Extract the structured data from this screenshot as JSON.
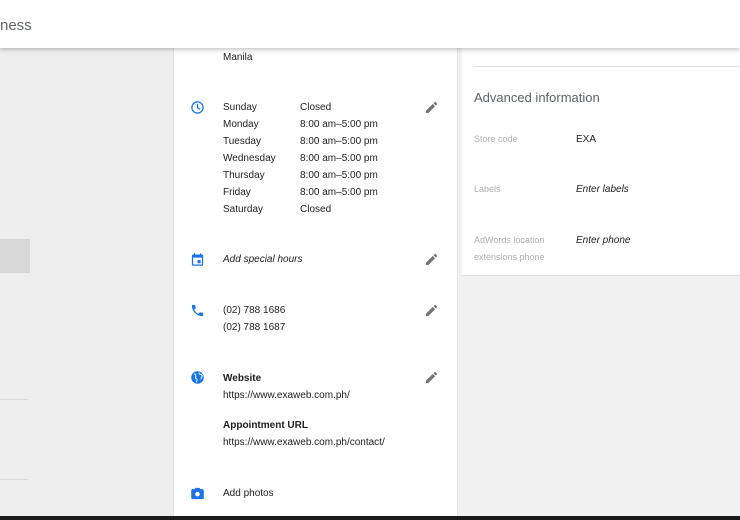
{
  "search": {
    "text": "ness"
  },
  "address": {
    "city": "Manila"
  },
  "hours": [
    {
      "day": "Sunday",
      "time": "Closed"
    },
    {
      "day": "Monday",
      "time": "8:00 am–5:00 pm"
    },
    {
      "day": "Tuesday",
      "time": "8:00 am–5:00 pm"
    },
    {
      "day": "Wednesday",
      "time": "8:00 am–5:00 pm"
    },
    {
      "day": "Thursday",
      "time": "8:00 am–5:00 pm"
    },
    {
      "day": "Friday",
      "time": "8:00 am–5:00 pm"
    },
    {
      "day": "Saturday",
      "time": "Closed"
    }
  ],
  "special_hours": {
    "label": "Add special hours"
  },
  "phones": [
    "(02) 788 1686",
    "(02) 788 1687"
  ],
  "website": {
    "title": "Website",
    "url": "https://www.exaweb.com.ph/",
    "appointment_title": "Appointment URL",
    "appointment_url": "https://www.exaweb.com.ph/contact/"
  },
  "photos": {
    "label": "Add photos"
  },
  "advanced": {
    "title": "Advanced information",
    "store_code_label": "Store code",
    "store_code_value": "EXA",
    "labels_label": "Labels",
    "labels_placeholder": "Enter labels",
    "adwords_label_line1": "AdWords location",
    "adwords_label_line2": "extensions phone",
    "adwords_placeholder": "Enter phone"
  },
  "colors": {
    "accent": "#1a73e8",
    "icon_grey": "#757575"
  }
}
